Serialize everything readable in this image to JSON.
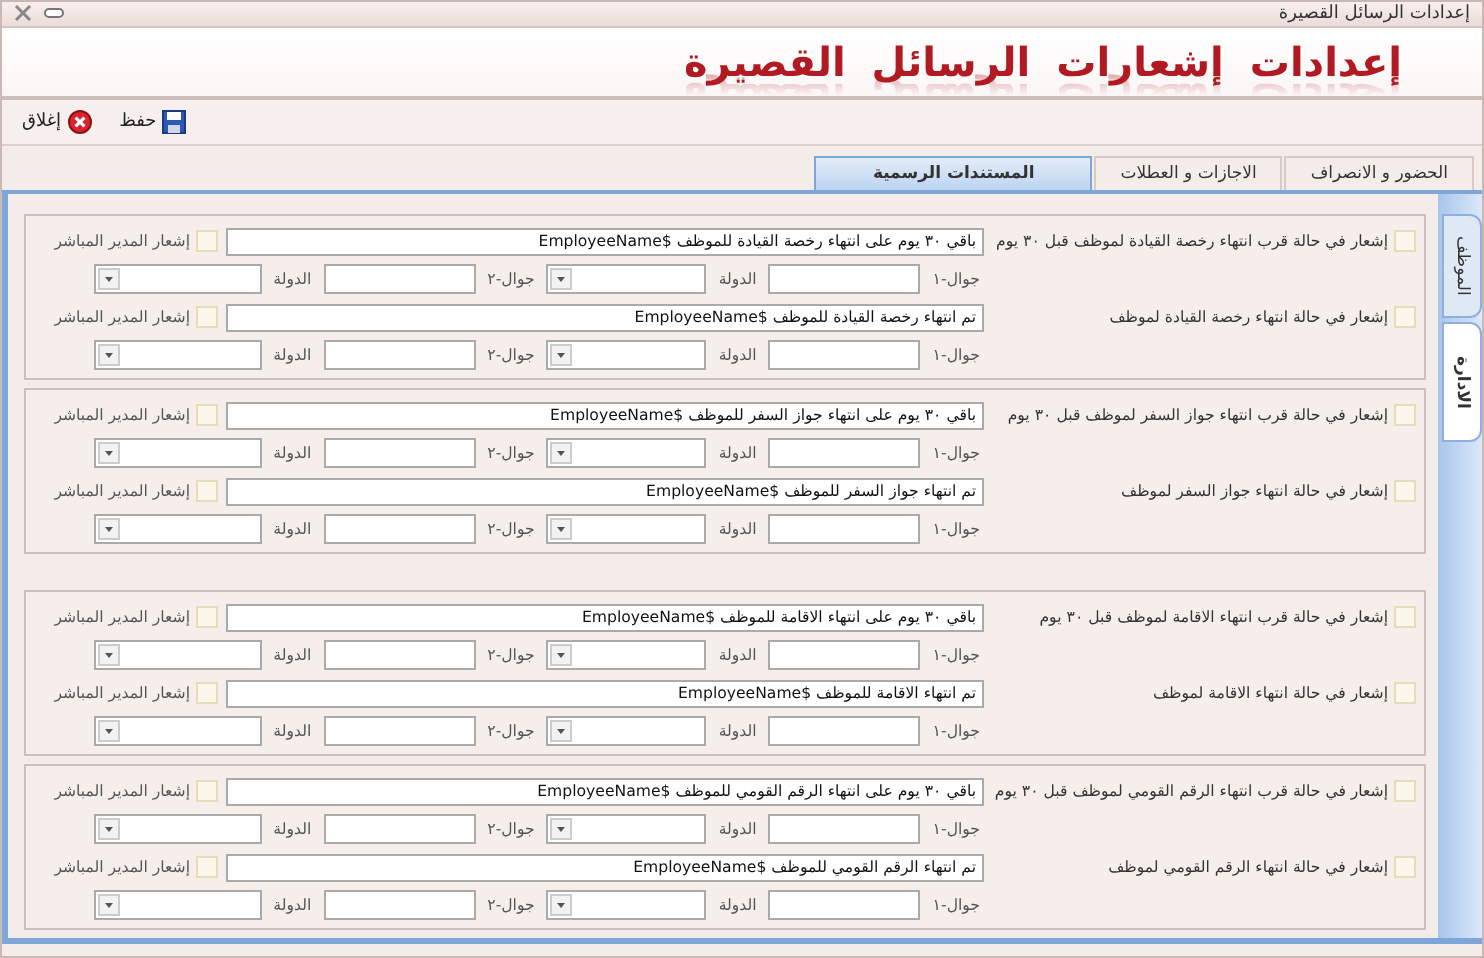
{
  "window": {
    "title": "إعدادات الرسائل القصيرة"
  },
  "header": {
    "title": "إعدادات إشعارات الرسائل القصيرة"
  },
  "toolbar": [
    {
      "kind": "save",
      "label": "حفظ"
    },
    {
      "kind": "close",
      "label": "إغلاق"
    }
  ],
  "tabs": [
    {
      "label": "الحضور و الانصراف",
      "selected": false
    },
    {
      "label": "الاجازات و العطلات",
      "selected": false
    },
    {
      "label": "المستندات الرسمية",
      "selected": true
    }
  ],
  "side_tabs": [
    {
      "label": "الموظف",
      "selected": false
    },
    {
      "label": "الادارة",
      "selected": true
    }
  ],
  "sections": [
    {
      "rows": [
        {
          "label": "إشعار في حالة قرب انتهاء رخصة القيادة لموظف قبل ٣٠ يوم",
          "checked": false,
          "message": "باقي ٣٠ يوم على انتهاء رخصة القيادة للموظف $EmployeeName",
          "manager_label": "إشعار المدير المباشر",
          "manager_checked": false,
          "mobile1_label": "جوال-١",
          "country1_label": "الدولة",
          "mobile2_label": "جوال-٢",
          "country2_label": "الدولة"
        },
        {
          "label": "إشعار في حالة انتهاء رخصة القيادة لموظف",
          "checked": false,
          "message": "تم انتهاء رخصة القيادة للموظف $EmployeeName",
          "manager_label": "إشعار المدير المباشر",
          "manager_checked": false,
          "mobile1_label": "جوال-١",
          "country1_label": "الدولة",
          "mobile2_label": "جوال-٢",
          "country2_label": "الدولة"
        }
      ]
    },
    {
      "rows": [
        {
          "label": "إشعار في حالة قرب انتهاء جواز السفر لموظف قبل ٣٠ يوم",
          "checked": false,
          "message": "باقي ٣٠ يوم على انتهاء جواز السفر للموظف $EmployeeName",
          "manager_label": "إشعار المدير المباشر",
          "manager_checked": false,
          "mobile1_label": "جوال-١",
          "country1_label": "الدولة",
          "mobile2_label": "جوال-٢",
          "country2_label": "الدولة"
        },
        {
          "label": "إشعار في حالة انتهاء جواز السفر لموظف",
          "checked": false,
          "message": "تم انتهاء جواز السفر للموظف $EmployeeName",
          "manager_label": "إشعار المدير المباشر",
          "manager_checked": false,
          "mobile1_label": "جوال-١",
          "country1_label": "الدولة",
          "mobile2_label": "جوال-٢",
          "country2_label": "الدولة"
        }
      ]
    },
    {
      "rows": [
        {
          "label": "إشعار في حالة قرب انتهاء الاقامة لموظف قبل ٣٠ يوم",
          "checked": false,
          "message": "باقي ٣٠ يوم على انتهاء الاقامة للموظف $EmployeeName",
          "manager_label": "إشعار المدير المباشر",
          "manager_checked": false,
          "mobile1_label": "جوال-١",
          "country1_label": "الدولة",
          "mobile2_label": "جوال-٢",
          "country2_label": "الدولة"
        },
        {
          "label": "إشعار في حالة انتهاء الاقامة لموظف",
          "checked": false,
          "message": "تم انتهاء الاقامة للموظف $EmployeeName",
          "manager_label": "إشعار المدير المباشر",
          "manager_checked": false,
          "mobile1_label": "جوال-١",
          "country1_label": "الدولة",
          "mobile2_label": "جوال-٢",
          "country2_label": "الدولة"
        }
      ]
    },
    {
      "rows": [
        {
          "label": "إشعار في حالة قرب انتهاء الرقم القومي لموظف قبل ٣٠ يوم",
          "checked": false,
          "message": "باقي ٣٠ يوم على انتهاء الرقم القومي للموظف $EmployeeName",
          "manager_label": "إشعار المدير المباشر",
          "manager_checked": false,
          "mobile1_label": "جوال-١",
          "country1_label": "الدولة",
          "mobile2_label": "جوال-٢",
          "country2_label": "الدولة"
        },
        {
          "label": "إشعار في حالة انتهاء الرقم القومي لموظف",
          "checked": false,
          "message": "تم انتهاء الرقم القومي للموظف $EmployeeName",
          "manager_label": "إشعار المدير المباشر",
          "manager_checked": false,
          "mobile1_label": "جوال-١",
          "country1_label": "الدولة",
          "mobile2_label": "جوال-٢",
          "country2_label": "الدولة"
        }
      ]
    }
  ]
}
